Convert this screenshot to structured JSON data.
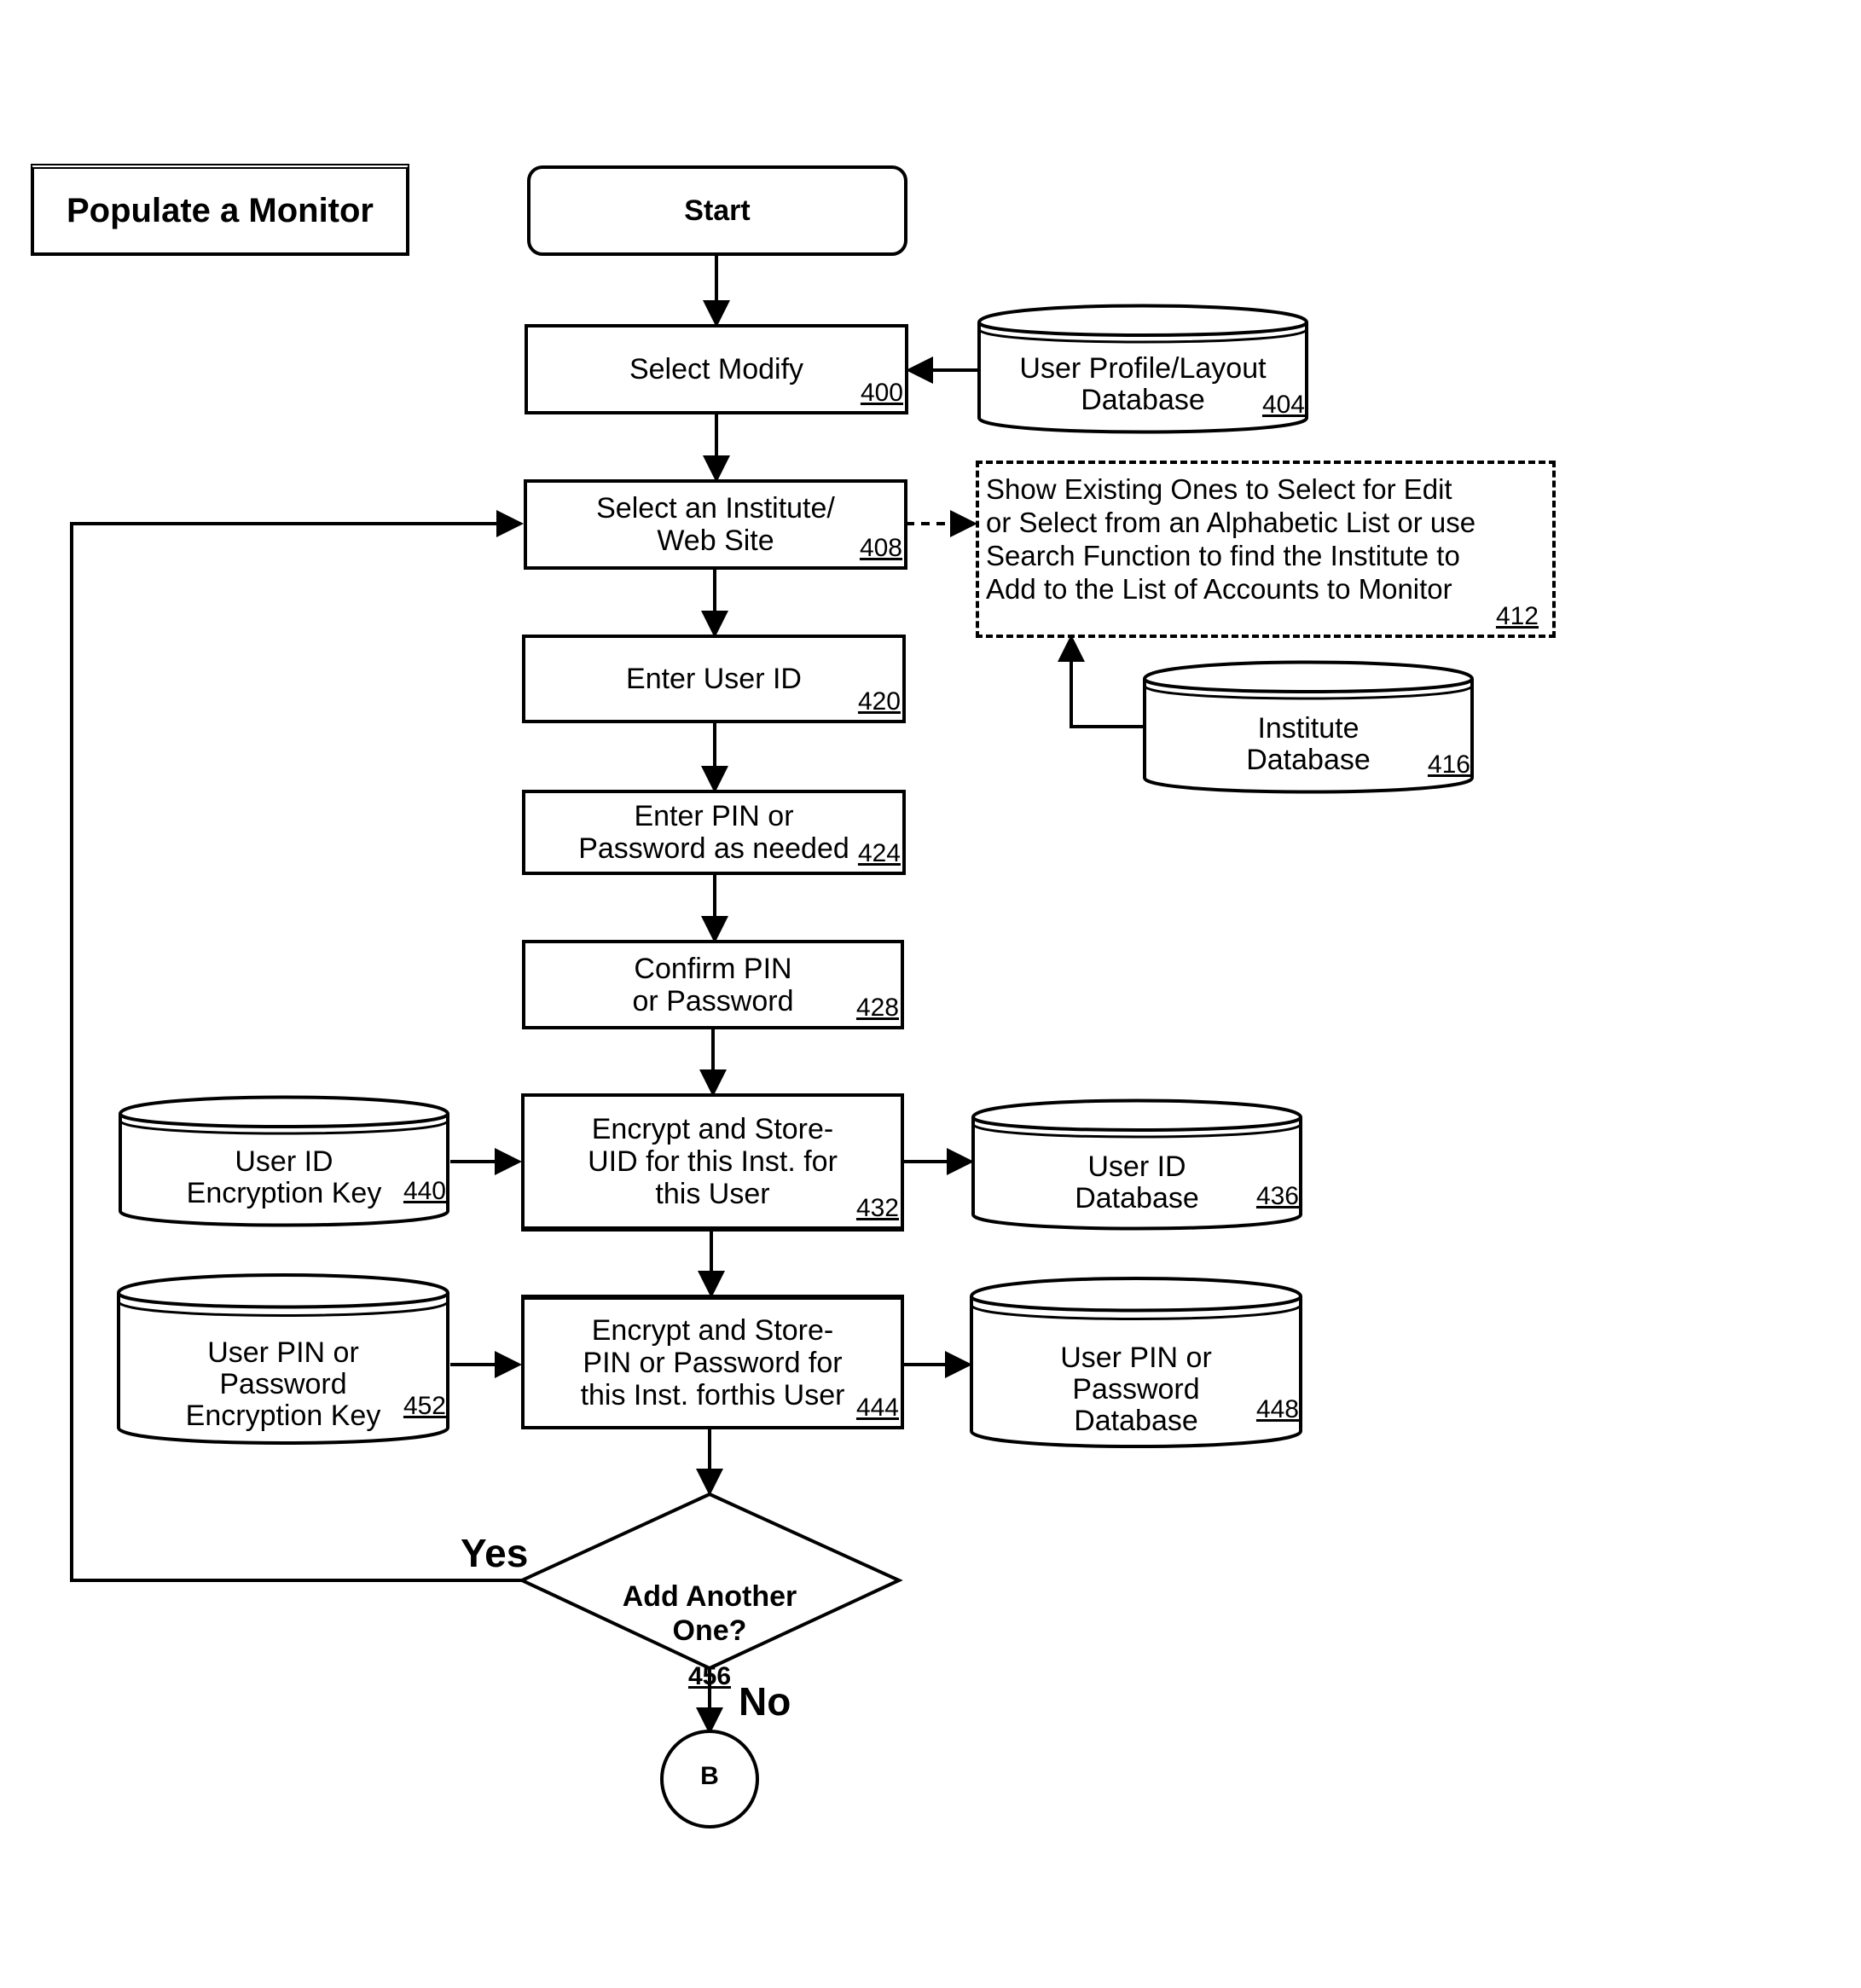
{
  "title": "Populate a Monitor",
  "nodes": {
    "start": {
      "label": "Start"
    },
    "select_modify": {
      "label": "Select Modify",
      "ref": "400"
    },
    "user_profile_db": {
      "label": "User Profile/Layout\nDatabase",
      "ref": "404"
    },
    "select_institute": {
      "label": "Select an Institute/\nWeb Site",
      "ref": "408"
    },
    "show_existing": {
      "label": "Show Existing Ones to Select for Edit\nor Select from an Alphabetic List or use\nSearch Function to find the Institute to\nAdd to the List of Accounts to Monitor",
      "ref": "412"
    },
    "institute_db": {
      "label": "Institute\nDatabase",
      "ref": "416"
    },
    "enter_user_id": {
      "label": "Enter User ID",
      "ref": "420"
    },
    "enter_pin": {
      "label": "Enter PIN or\nPassword as needed",
      "ref": "424"
    },
    "confirm_pin": {
      "label": "Confirm PIN\nor Password",
      "ref": "428"
    },
    "encrypt_uid": {
      "label": "Encrypt and Store-\nUID for this Inst. for\nthis User",
      "ref": "432"
    },
    "user_id_db": {
      "label": "User ID\nDatabase",
      "ref": "436"
    },
    "user_id_key": {
      "label": "User ID\nEncryption Key",
      "ref": "440"
    },
    "encrypt_pin": {
      "label": "Encrypt and Store-\nPIN or Password for\nthis Inst. forthis User",
      "ref": "444"
    },
    "pin_db": {
      "label": "User PIN or\nPassword\nDatabase",
      "ref": "448"
    },
    "pin_key": {
      "label": "User PIN or\nPassword\nEncryption Key",
      "ref": "452"
    },
    "decision": {
      "label": "Add Another\nOne?",
      "ref": "456"
    },
    "connector_b": {
      "label": "B"
    }
  },
  "edges": {
    "yes_label": "Yes",
    "no_label": "No"
  }
}
